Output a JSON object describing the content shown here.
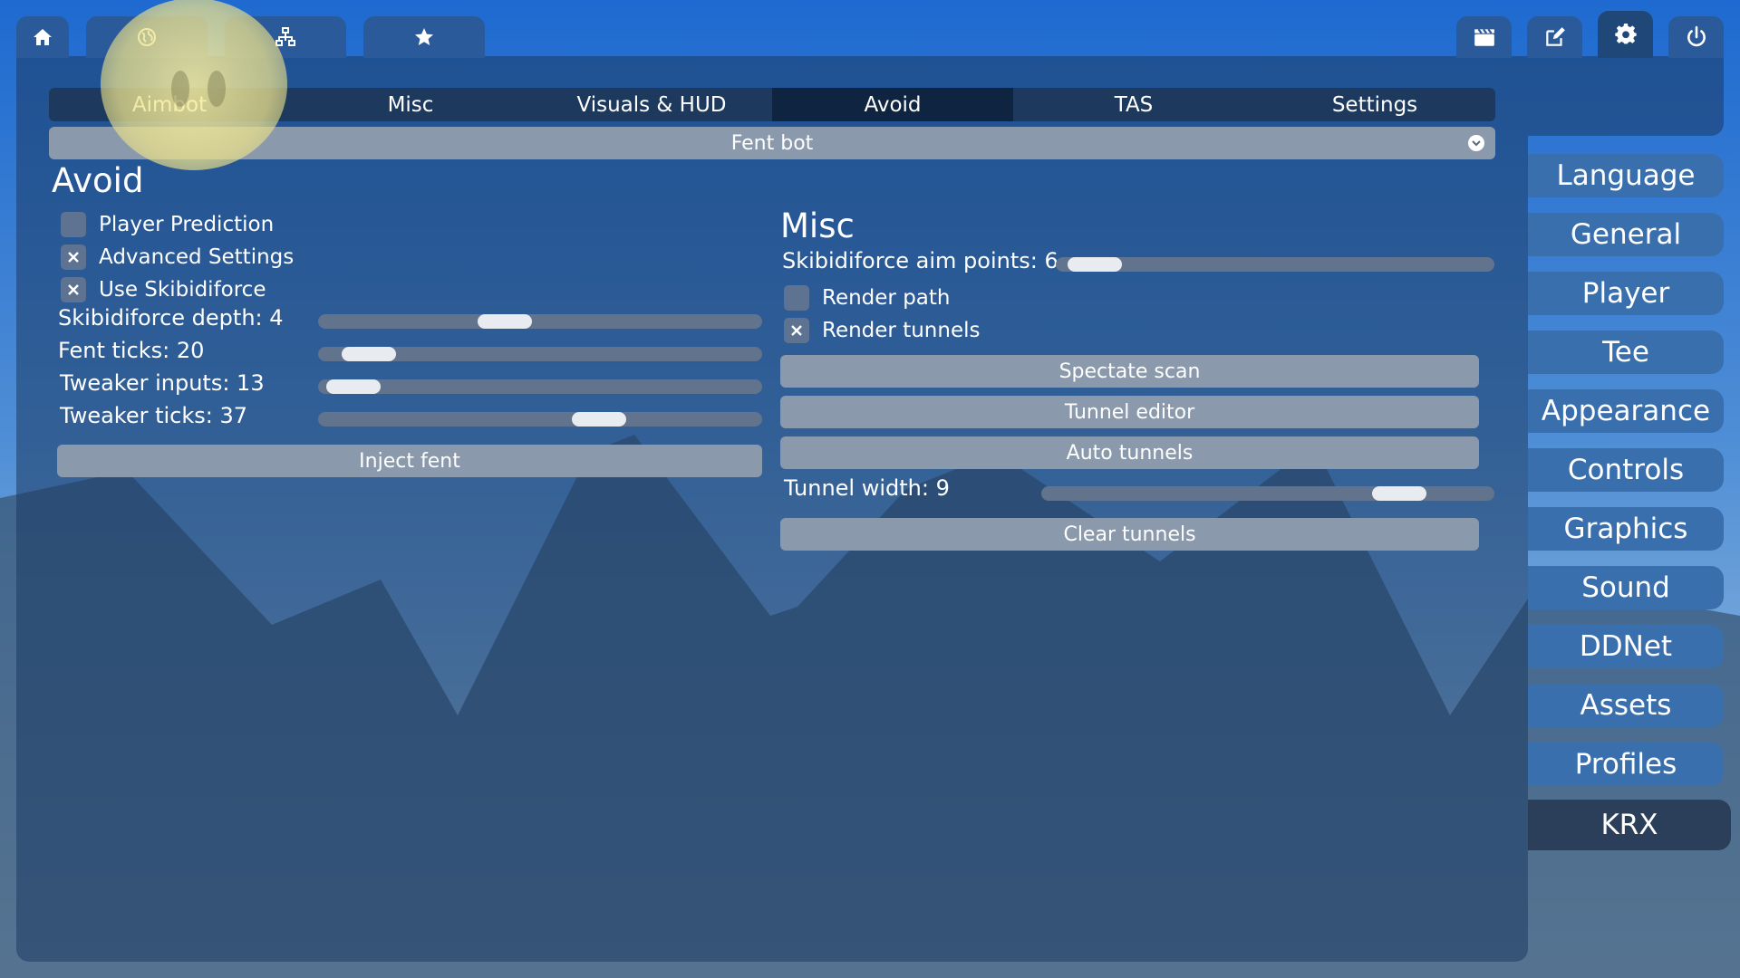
{
  "topbar": {
    "left_buttons": [
      {
        "icon": "home-icon"
      },
      {
        "icon": "globe-icon"
      },
      {
        "icon": "network-icon"
      },
      {
        "icon": "star-icon"
      }
    ],
    "right_buttons": [
      {
        "icon": "clapperboard-icon"
      },
      {
        "icon": "edit-icon"
      },
      {
        "icon": "gear-icon",
        "active": true
      },
      {
        "icon": "power-icon"
      }
    ]
  },
  "tabs": [
    {
      "label": "Aimbot"
    },
    {
      "label": "Misc"
    },
    {
      "label": "Visuals & HUD"
    },
    {
      "label": "Avoid",
      "active": true
    },
    {
      "label": "TAS"
    },
    {
      "label": "Settings"
    }
  ],
  "profile_select": {
    "value": "Fent bot"
  },
  "avoid": {
    "title": "Avoid",
    "checkboxes": [
      {
        "label": "Player Prediction",
        "checked": false
      },
      {
        "label": "Advanced Settings",
        "checked": true
      },
      {
        "label": "Use Skibidiforce",
        "checked": true
      }
    ],
    "sliders": [
      {
        "label": "Skibidiforce depth: 4",
        "fraction": 0.41
      },
      {
        "label": "Fent ticks: 20",
        "fraction": 0.06
      },
      {
        "label": "Tweaker inputs: 13",
        "fraction": 0.02
      },
      {
        "label": "Tweaker ticks: 37",
        "fraction": 0.65
      }
    ],
    "inject_button": "Inject fent"
  },
  "misc": {
    "title": "Misc",
    "aim_points": {
      "label": "Skibidiforce aim points: 6",
      "fraction": 0.03
    },
    "checkboxes": [
      {
        "label": "Render path",
        "checked": false
      },
      {
        "label": "Render tunnels",
        "checked": true
      }
    ],
    "buttons": [
      "Spectate scan",
      "Tunnel editor",
      "Auto tunnels"
    ],
    "tunnel_width": {
      "label": "Tunnel width: 9",
      "fraction": 0.83
    },
    "clear_button": "Clear tunnels"
  },
  "sidebar": {
    "items": [
      {
        "label": "Language"
      },
      {
        "label": "General"
      },
      {
        "label": "Player"
      },
      {
        "label": "Tee"
      },
      {
        "label": "Appearance"
      },
      {
        "label": "Controls"
      },
      {
        "label": "Graphics"
      },
      {
        "label": "Sound"
      },
      {
        "label": "DDNet"
      },
      {
        "label": "Assets"
      },
      {
        "label": "Profiles"
      },
      {
        "label": "KRX",
        "active": true
      }
    ]
  },
  "colors": {
    "accent": "#1e6ad0",
    "panel": "#1d3a5e",
    "button": "#8b99ad"
  }
}
